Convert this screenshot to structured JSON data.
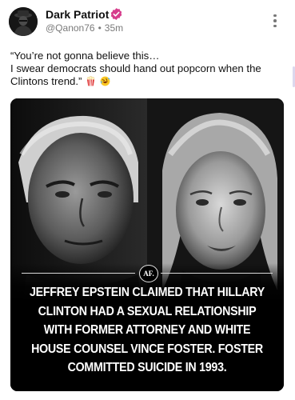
{
  "post": {
    "author": {
      "display_name": "Dark Patriot",
      "verified": true,
      "avatar_icon": "avatar-silhouette-icon"
    },
    "handle": "@Qanon76",
    "time_ago": "35m",
    "separator": "•",
    "text_line_1": "“You’re not gonna believe this…",
    "text_line_2": "I swear democrats should hand out popcorn when the",
    "text_line_3": "Clintons trend.”",
    "emojis": [
      "popcorn-emoji",
      "rolling-laughing-emoji"
    ],
    "image": {
      "badge": "AF.",
      "headline": "JEFFREY EPSTEIN CLAIMED THAT HILLARY CLINTON HAD A SEXUAL RELATIONSHIP WITH FORMER ATTORNEY AND WHITE HOUSE COUNSEL VINCE FOSTER. FOSTER COMMITTED SUICIDE IN 1993."
    }
  },
  "colors": {
    "verified_badge": "#d63c8c",
    "meta_text": "#7a7a7a",
    "background": "#ffffff"
  }
}
